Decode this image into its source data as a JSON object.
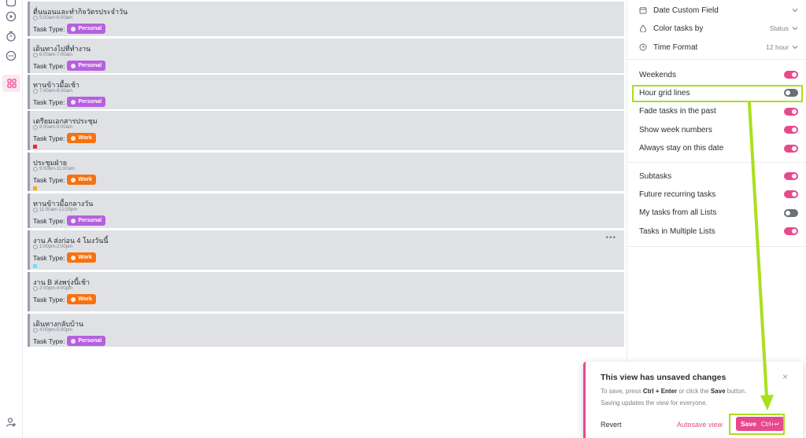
{
  "rail": {
    "icons": [
      "inbox-icon",
      "play-circle-icon",
      "timer-icon",
      "more-circle-icon",
      "grid-icon",
      "add-user-icon"
    ]
  },
  "tasks": [
    {
      "title": "ตื่นนอนและทำกิจวัตรประจำวัน",
      "time": "5:00am-6:00am",
      "type_label": "Task Type:",
      "badge": "Personal",
      "badge_kind": "personal",
      "flag": null
    },
    {
      "title": "เดินทางไปที่ทำงาน",
      "time": "6:00am-7:00am",
      "type_label": "Task Type:",
      "badge": "Personal",
      "badge_kind": "personal",
      "flag": null
    },
    {
      "title": "ทานข้าวมื้อเช้า",
      "time": "7:00am-8:00am",
      "type_label": "Task Type:",
      "badge": "Personal",
      "badge_kind": "personal",
      "flag": null
    },
    {
      "title": "เตรียมเอกสารประชุม",
      "time": "8:00am-9:00am",
      "type_label": "Task Type:",
      "badge": "Work",
      "badge_kind": "work",
      "flag": "#f1292f"
    },
    {
      "title": "ประชุมฝ่าย",
      "time": "9:00am-11:00am",
      "type_label": "Task Type:",
      "badge": "Work",
      "badge_kind": "work",
      "flag": "#f8ae00"
    },
    {
      "title": "ทานข้าวมื้อกลางวัน",
      "time": "11:00am-12:00pm",
      "type_label": "Task Type:",
      "badge": "Personal",
      "badge_kind": "personal",
      "flag": null
    },
    {
      "title": "งาน A ส่งก่อน 4 โมงวันนี้",
      "time": "1:00pm-2:00pm",
      "type_label": "Task Type:",
      "badge": "Work",
      "badge_kind": "work",
      "flag": "#6fddff"
    },
    {
      "title": "งาน B ส่งพรุ่งนี้เช้า",
      "time": "2:00pm-4:00pm",
      "type_label": "Task Type:",
      "badge": "Work",
      "badge_kind": "work",
      "flag": null
    },
    {
      "title": "เดินทางกลับบ้าน",
      "time": "4:00pm-5:00pm",
      "type_label": "Task Type:",
      "badge": "Personal",
      "badge_kind": "personal",
      "flag": null
    }
  ],
  "more_menu": "•••",
  "panel": {
    "date_custom_field": "Date Custom Field",
    "color_tasks_by": "Color tasks by",
    "color_tasks_by_value": "Status",
    "time_format": "Time Format",
    "time_format_value": "12 hour",
    "toggles_a": [
      {
        "label": "Weekends",
        "on": true
      },
      {
        "label": "Hour grid lines",
        "on": false
      },
      {
        "label": "Fade tasks in the past",
        "on": true
      },
      {
        "label": "Show week numbers",
        "on": true
      },
      {
        "label": "Always stay on this date",
        "on": true
      }
    ],
    "toggles_b": [
      {
        "label": "Subtasks",
        "on": true
      },
      {
        "label": "Future recurring tasks",
        "on": true
      },
      {
        "label": "My tasks from all Lists",
        "on": false
      },
      {
        "label": "Tasks in Multiple Lists",
        "on": true
      }
    ]
  },
  "toast": {
    "title": "This view has unsaved changes",
    "line1_pre": "To save, press ",
    "line1_keys": "Ctrl + Enter",
    "line1_mid": " or click the ",
    "line1_save": "Save",
    "line1_post": " button.",
    "line2": "Saving updates the view for everyone.",
    "close": "×",
    "revert": "Revert",
    "autosave": "Autosave view",
    "save": "Save",
    "shortcut": "Ctrl+↵"
  },
  "colors": {
    "accent": "#e8488d",
    "highlight": "#a9e01c",
    "personal": "#b660e0",
    "work": "#f7720f"
  }
}
